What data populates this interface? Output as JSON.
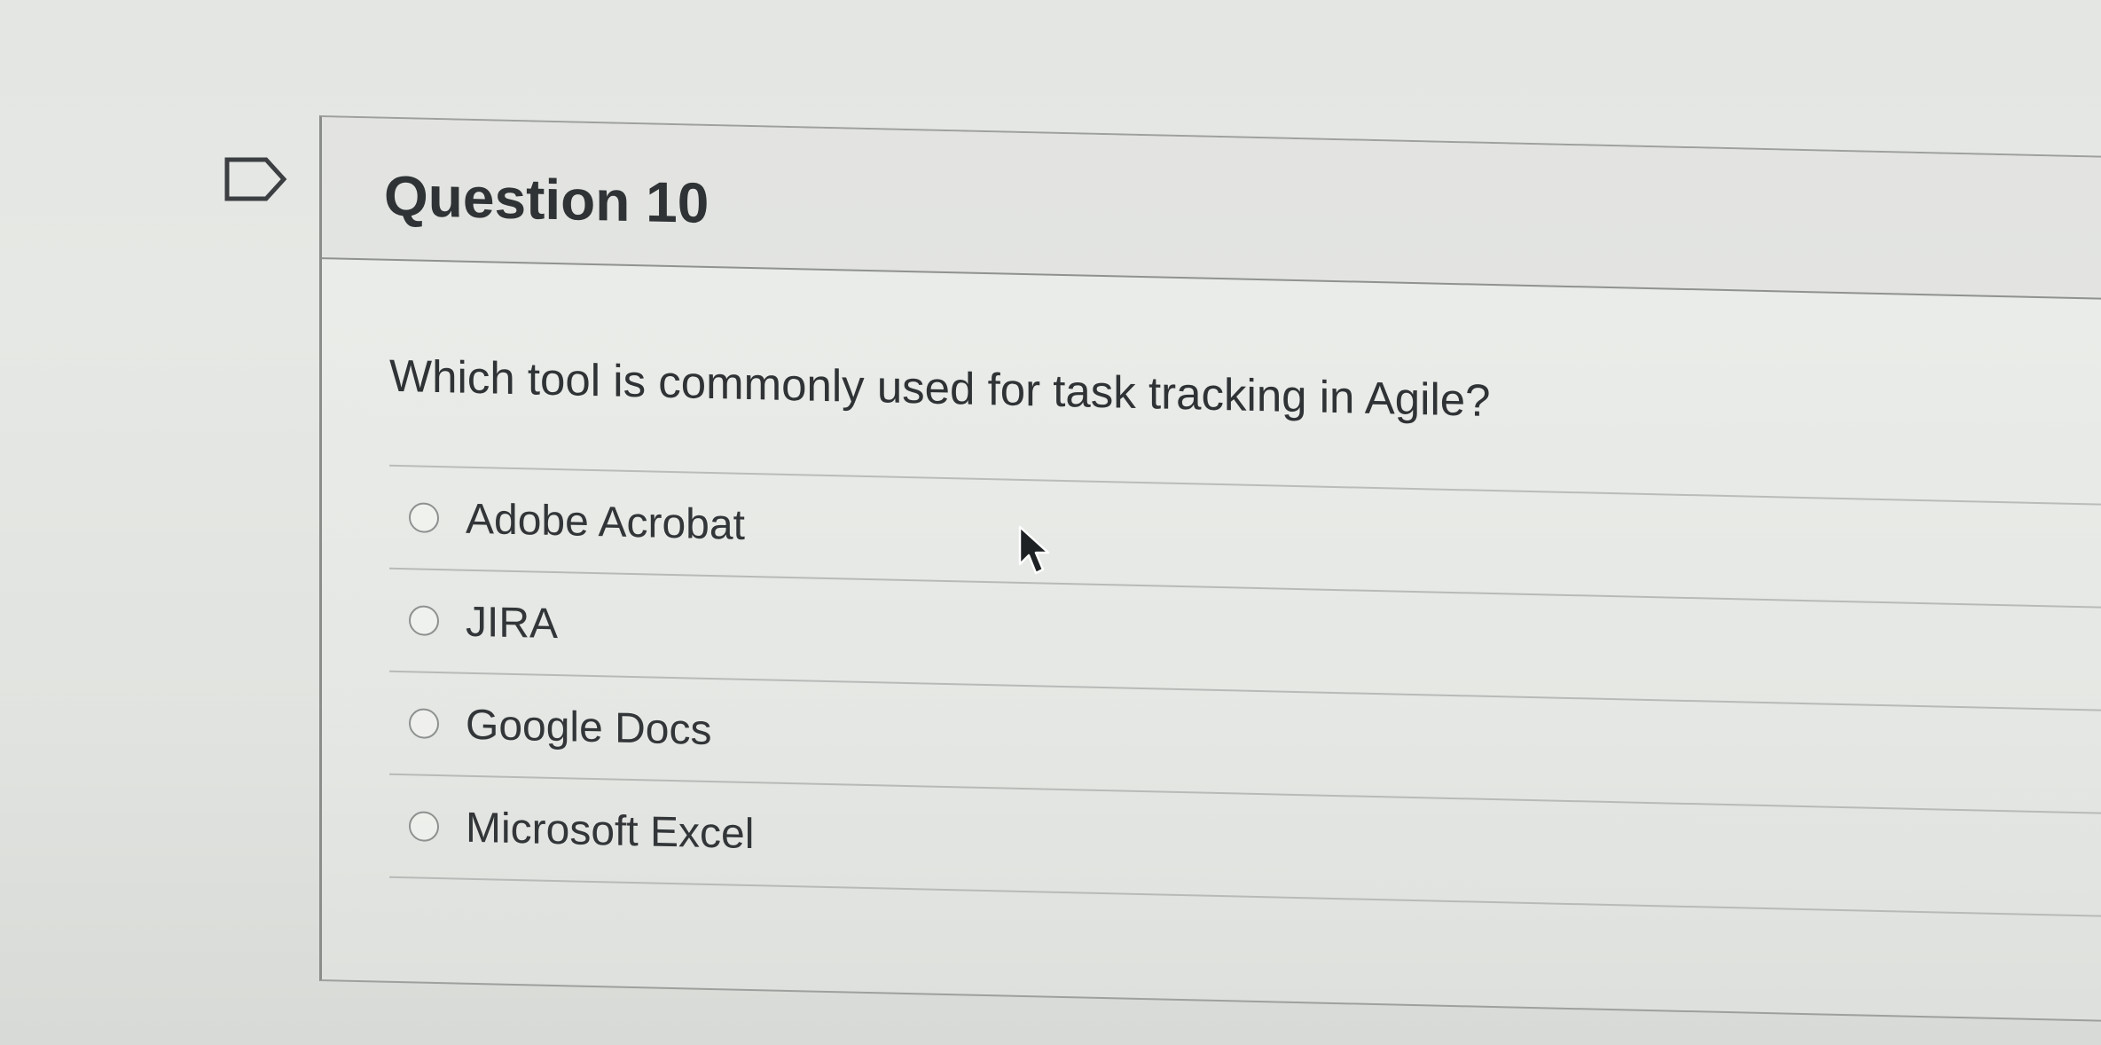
{
  "question": {
    "title": "Question 10",
    "prompt": "Which tool is commonly used for task tracking in Agile?",
    "options": [
      {
        "label": "Adobe Acrobat",
        "selected": false
      },
      {
        "label": "JIRA",
        "selected": false
      },
      {
        "label": "Google Docs",
        "selected": false
      },
      {
        "label": "Microsoft Excel",
        "selected": false
      }
    ]
  },
  "icons": {
    "flag": "flag-question-icon",
    "cursor": "mouse-pointer-icon"
  },
  "colors": {
    "text": "#2f3335",
    "border": "#8f928f",
    "background": "#e4e6e3"
  }
}
